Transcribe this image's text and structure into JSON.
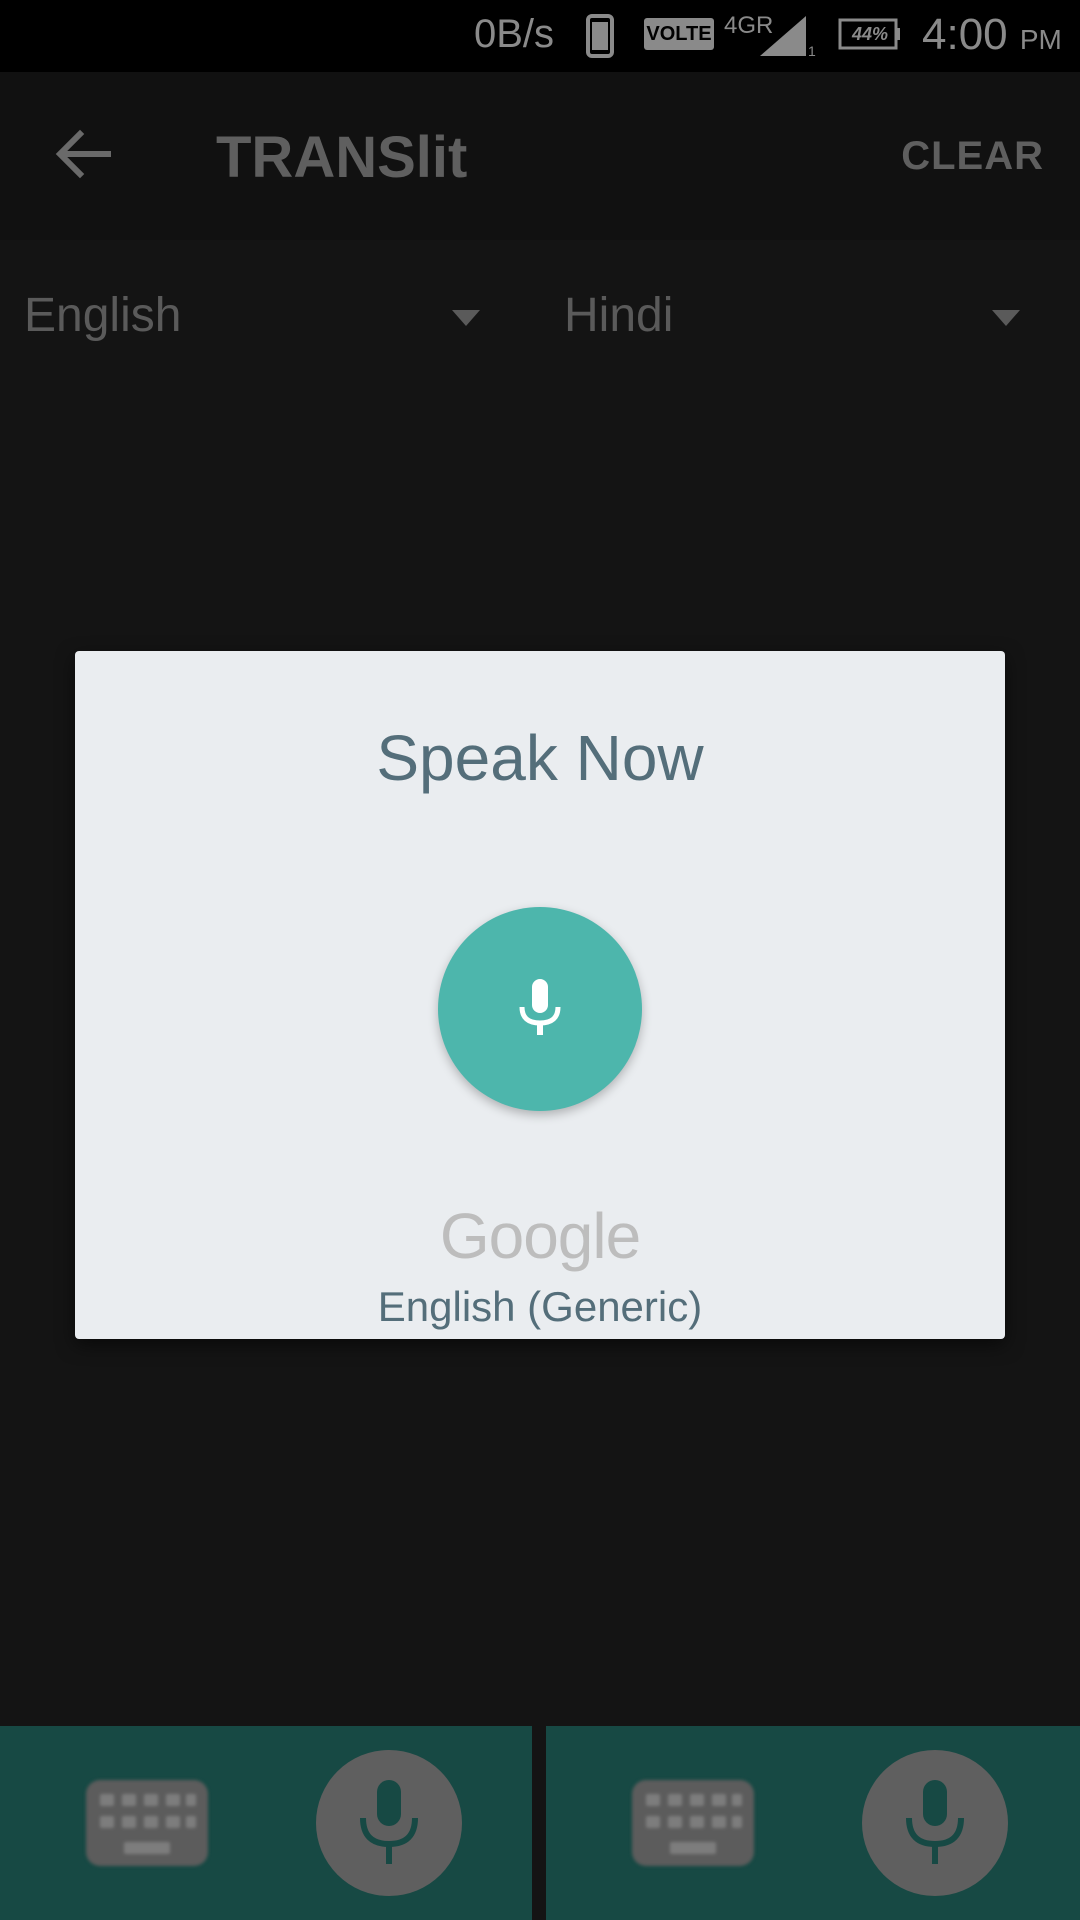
{
  "status_bar": {
    "speed": "0B/s",
    "volte": "VOLTE",
    "net_type": "4GR",
    "battery": "44%",
    "time": "4:00",
    "ampm": "PM"
  },
  "app_bar": {
    "title": "TRANSlit",
    "clear_label": "CLEAR",
    "back_icon": "arrow-left-icon"
  },
  "languages": {
    "source": "English",
    "target": "Hindi"
  },
  "dialog": {
    "title": "Speak Now",
    "brand": "Google",
    "language": "English (Generic)",
    "mic_icon": "microphone-icon"
  },
  "bottom_bar": {
    "left_icons": [
      "keyboard-icon",
      "microphone-icon"
    ],
    "right_icons": [
      "keyboard-icon",
      "microphone-icon"
    ]
  },
  "colors": {
    "accent": "#4db6ac",
    "dialog_text": "#546e7a",
    "bottom_bar": "#174944",
    "background": "#141414"
  }
}
